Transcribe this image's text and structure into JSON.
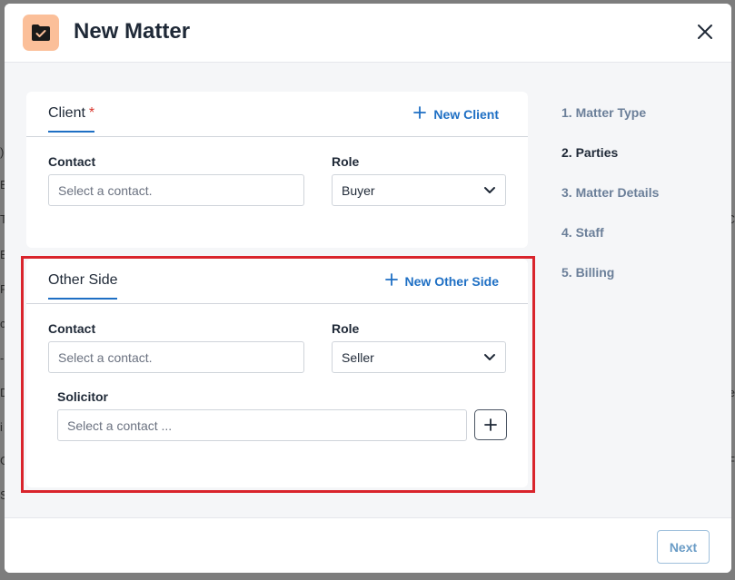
{
  "backdrop": {
    "left_fragments": [
      ")",
      "B",
      "T",
      "B",
      "P",
      "c",
      "-",
      "D",
      "i",
      "G",
      "S"
    ],
    "right_fragments": [
      "C",
      "e",
      "F"
    ]
  },
  "modal": {
    "title": "New Matter",
    "header_icon": "folder-check-icon",
    "close_icon": "close-icon"
  },
  "client": {
    "tab_label": "Client",
    "required_mark": "*",
    "new_link": "New Client",
    "contact_label": "Contact",
    "contact_placeholder": "Select a contact.",
    "role_label": "Role",
    "role_value": "Buyer"
  },
  "other_side": {
    "tab_label": "Other Side",
    "new_link": "New Other Side",
    "contact_label": "Contact",
    "contact_placeholder": "Select a contact.",
    "role_label": "Role",
    "role_value": "Seller",
    "solicitor_label": "Solicitor",
    "solicitor_placeholder": "Select a contact ..."
  },
  "steps": [
    {
      "label": "1. Matter Type",
      "active": false
    },
    {
      "label": "2. Parties",
      "active": true
    },
    {
      "label": "3. Matter Details",
      "active": false
    },
    {
      "label": "4. Staff",
      "active": false
    },
    {
      "label": "5. Billing",
      "active": false
    }
  ],
  "footer": {
    "next_label": "Next"
  },
  "colors": {
    "accent": "#1e6fc4",
    "highlight": "#d9242c",
    "icon_bg": "#fbbf99"
  }
}
